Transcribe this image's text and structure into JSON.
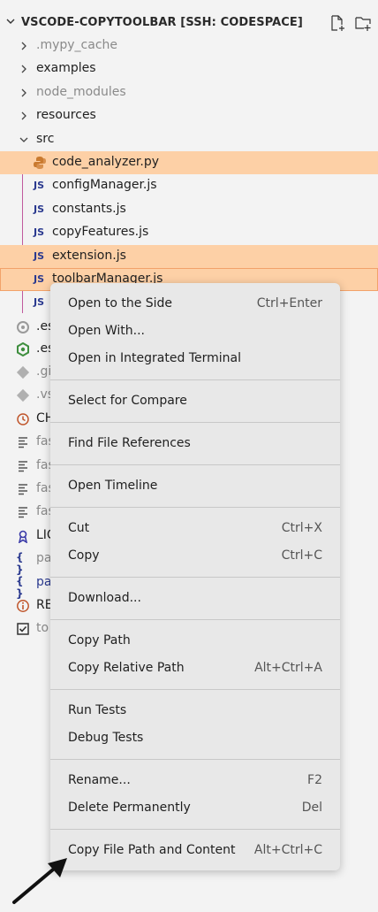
{
  "explorer": {
    "title": "VSCODE-COPYTOOLBAR [SSH: CODESPACE]",
    "header_icons": [
      "new-file-icon",
      "new-folder-icon"
    ],
    "items": [
      {
        "label": ".mypy_cache"
      },
      {
        "label": "examples"
      },
      {
        "label": "node_modules"
      },
      {
        "label": "resources"
      },
      {
        "label": "src"
      },
      {
        "label": "code_analyzer.py"
      },
      {
        "label": "configManager.js"
      },
      {
        "label": "constants.js"
      },
      {
        "label": "copyFeatures.js"
      },
      {
        "label": "extension.js"
      },
      {
        "label": "toolbarManager.js"
      },
      {
        "label": ""
      },
      {
        "label": ".es"
      },
      {
        "label": ".es"
      },
      {
        "label": ".gi"
      },
      {
        "label": ".vs"
      },
      {
        "label": "CH"
      },
      {
        "label": "fas"
      },
      {
        "label": "fas"
      },
      {
        "label": "fas"
      },
      {
        "label": "fas"
      },
      {
        "label": "LIC"
      },
      {
        "label": "pa"
      },
      {
        "label": "pa"
      },
      {
        "label": "RE"
      },
      {
        "label": "to"
      }
    ],
    "js_badge": "JS",
    "colors": {
      "highlight": "#fdd0a6",
      "guide": "#c05a9d",
      "js": "#2b3a8f"
    }
  },
  "menu": {
    "groups": [
      [
        {
          "label": "Open to the Side",
          "shortcut": "Ctrl+Enter"
        },
        {
          "label": "Open With...",
          "shortcut": ""
        },
        {
          "label": "Open in Integrated Terminal",
          "shortcut": ""
        }
      ],
      [
        {
          "label": "Select for Compare",
          "shortcut": ""
        }
      ],
      [
        {
          "label": "Find File References",
          "shortcut": ""
        }
      ],
      [
        {
          "label": "Open Timeline",
          "shortcut": ""
        }
      ],
      [
        {
          "label": "Cut",
          "shortcut": "Ctrl+X"
        },
        {
          "label": "Copy",
          "shortcut": "Ctrl+C"
        }
      ],
      [
        {
          "label": "Download...",
          "shortcut": ""
        }
      ],
      [
        {
          "label": "Copy Path",
          "shortcut": ""
        },
        {
          "label": "Copy Relative Path",
          "shortcut": "Alt+Ctrl+A"
        }
      ],
      [
        {
          "label": "Run Tests",
          "shortcut": ""
        },
        {
          "label": "Debug Tests",
          "shortcut": ""
        }
      ],
      [
        {
          "label": "Rename...",
          "shortcut": "F2"
        },
        {
          "label": "Delete Permanently",
          "shortcut": "Del"
        }
      ],
      [
        {
          "label": "Copy File Path and Content",
          "shortcut": "Alt+Ctrl+C"
        }
      ]
    ]
  }
}
